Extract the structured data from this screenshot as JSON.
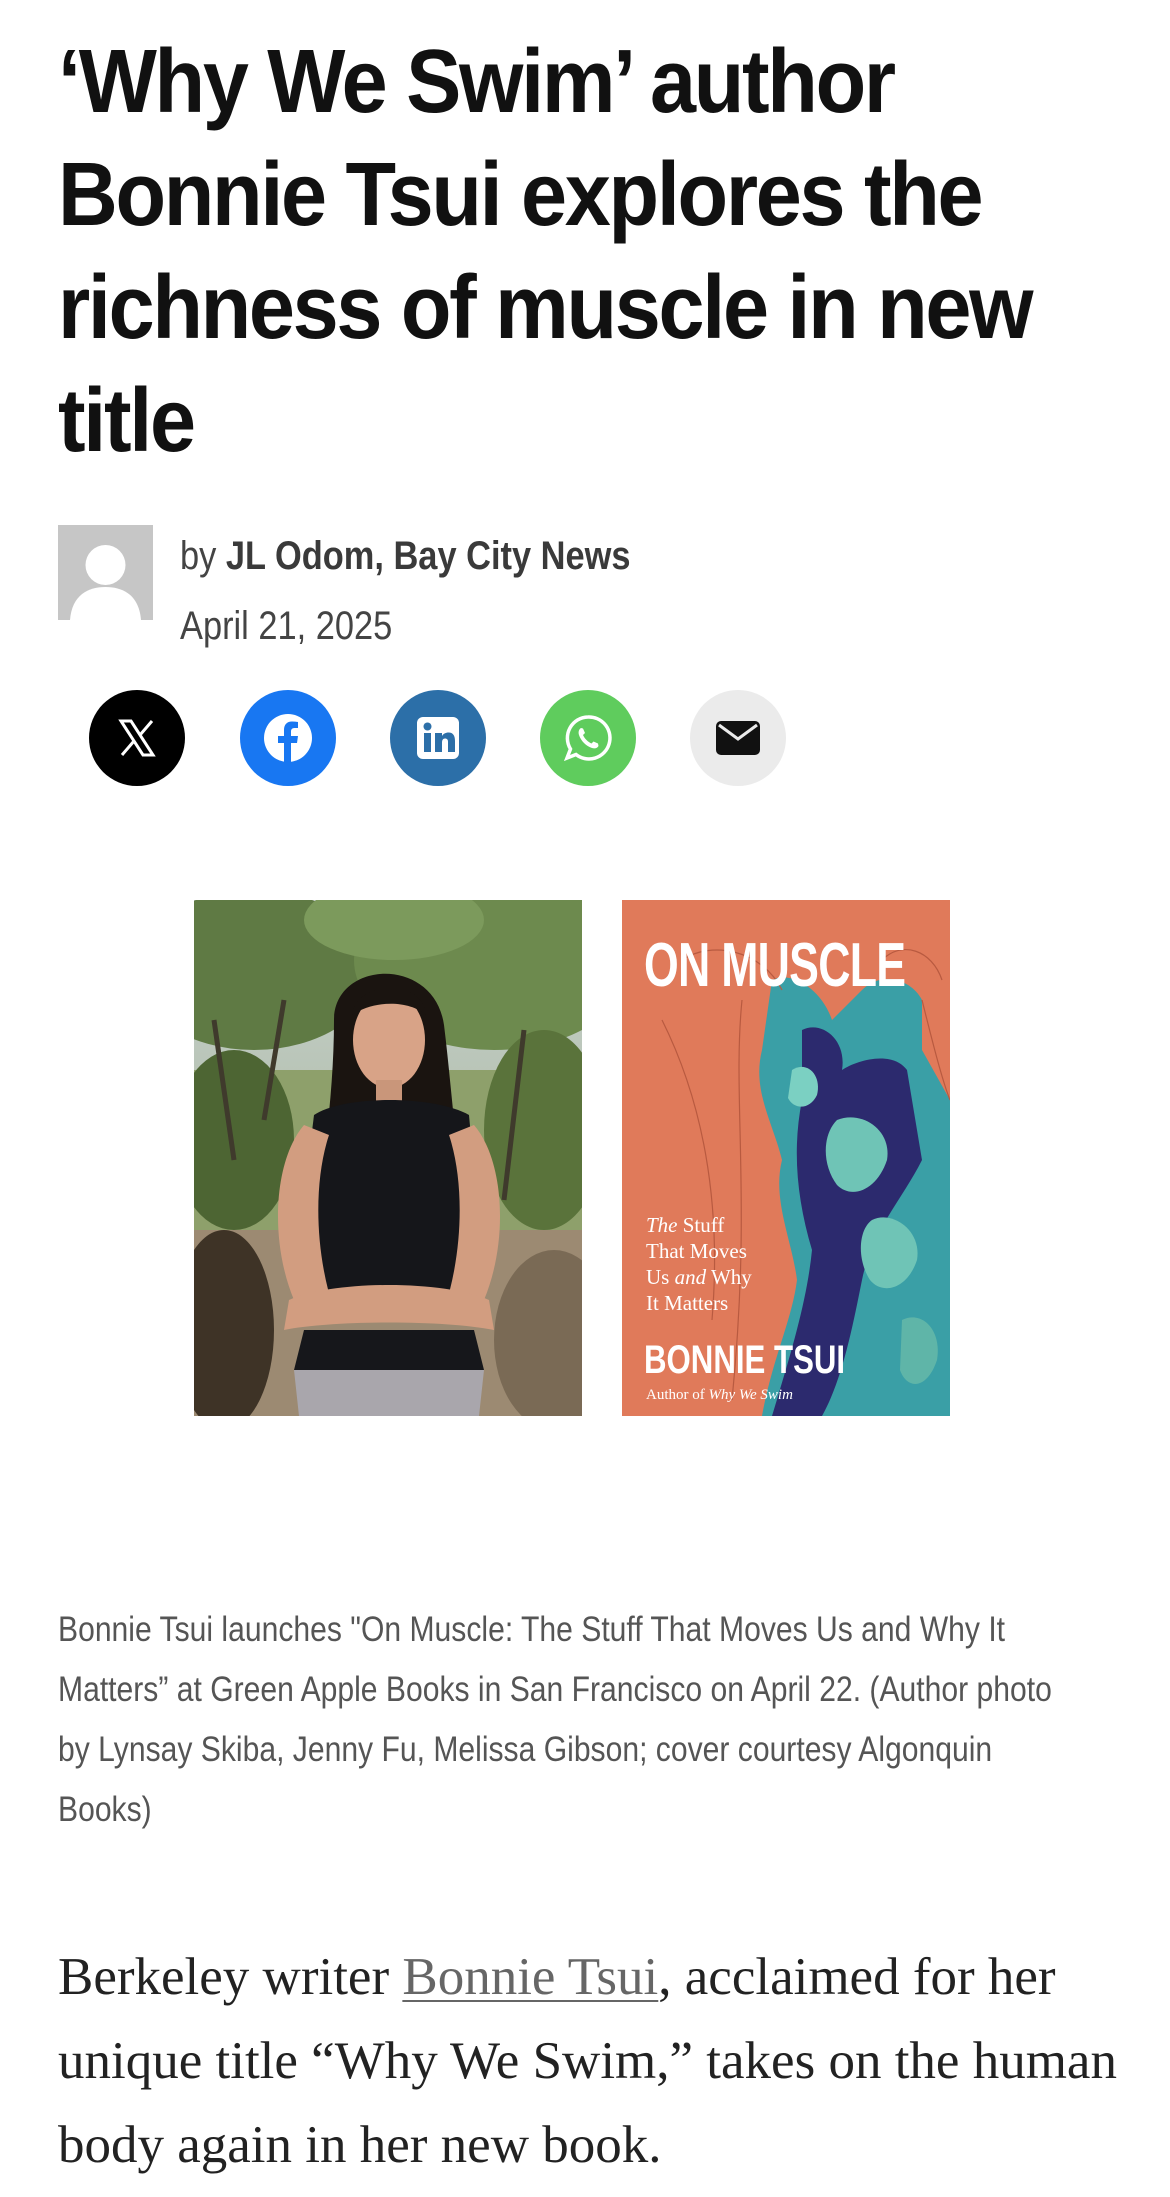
{
  "article": {
    "headline": "‘Why We Swim’ author Bonnie Tsui explores the richness of muscle in new title",
    "byline_prefix": "by",
    "author": "JL Odom, Bay City News",
    "date": "April 21, 2025"
  },
  "share": {
    "buttons": [
      {
        "icon": "x-icon",
        "color": "#000000"
      },
      {
        "icon": "facebook-icon",
        "color": "#1877f2"
      },
      {
        "icon": "linkedin-icon",
        "color": "#2c6fa8"
      },
      {
        "icon": "whatsapp-icon",
        "color": "#5fcc5d"
      },
      {
        "icon": "email-icon",
        "color": "#ebebeb"
      }
    ]
  },
  "figure": {
    "cover_title": "ON MUSCLE",
    "cover_subtitle_the": "The",
    "cover_subtitle_l1": "Stuff",
    "cover_subtitle_l2": "That Moves",
    "cover_subtitle_l3a": "Us",
    "cover_subtitle_and": "and",
    "cover_subtitle_l3b": "Why",
    "cover_subtitle_l4": "It Matters",
    "cover_author": "BONNIE TSUI",
    "cover_tagline_prefix": "Author of",
    "cover_tagline_title": "Why We Swim",
    "caption": "Bonnie Tsui launches \"On Muscle: The Stuff That Moves Us and Why It Matters” at Green Apple Books in San Francisco on April 22. (Author photo by Lynsay Skiba, Jenny Fu, Melissa Gibson; cover courtesy Algonquin Books)"
  },
  "body": {
    "p1_before": "Berkeley writer ",
    "p1_link": "Bonnie Tsui",
    "p1_after": ", acclaimed for her unique title “Why We Swim,” takes on the human body again in her new book."
  },
  "colors": {
    "headline": "#111111",
    "meta": "#444444",
    "caption": "#555555",
    "cover_bg": "#e07a5a"
  }
}
